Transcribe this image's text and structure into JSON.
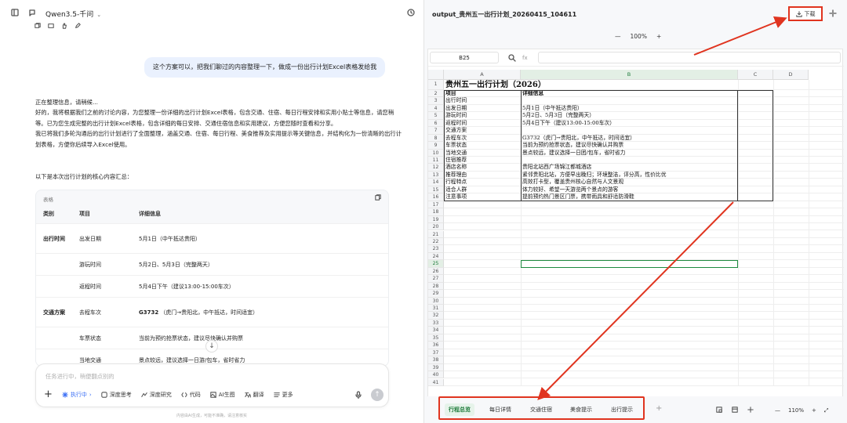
{
  "left": {
    "model_name": "Qwen3.5-千问",
    "user_message": "这个方案可以，把我们聊过的内容整理一下，做成一份出行计划Excel表格发给我",
    "assistant_paragraphs": [
      "正在整理信息，请稍候...",
      "好的，我将根据我们之前的讨论内容，为您整理一份详细的出行计划Excel表格，包含交通、住宿、每日行程安排和实用小贴士等信息，请您稍等。已为您生成完整的出行计划Excel表格，包含详细的每日安排、交通住宿信息和实用建议，方便您随时查看和分享。",
      "我已将我们多轮沟通后的出行计划进行了全面整理，涵盖交通、住宿、每日行程、美食推荐及实用提示等关键信息，并结构化为一份清晰的出行计划表格，方便你后续导入Excel使用。"
    ],
    "summary_text": "以下是本次出行计划的核心内容汇总：",
    "table_label": "表格",
    "table_headers": [
      "类别",
      "项目",
      "详细信息"
    ],
    "table_rows": [
      {
        "cat": "出行时间",
        "item": "出发日期",
        "detail": "5月1日（中午抵达贵阳）",
        "bold": false
      },
      {
        "cat": "",
        "item": "游玩时间",
        "detail": "5月2日、5月3日（完整两天）",
        "bold": false
      },
      {
        "cat": "",
        "item": "返程时间",
        "detail": "5月4日下午（建议13:00-15:00车次）",
        "bold": false
      },
      {
        "cat": "交通方案",
        "item": "去程车次",
        "detail_bold": "G3732",
        "detail": "（虎门→贵阳北，中午抵达，时间适宜）",
        "bold": true
      },
      {
        "cat": "",
        "item": "车票状态",
        "detail": "当前为预约抢票状态，建议尽快确认并购票",
        "bold": false
      },
      {
        "cat": "",
        "item": "当地交通",
        "detail": "景点较远，建议选择一日游/包车，省时省力",
        "bold": false
      }
    ],
    "input_placeholder": "任务进行中，稍便翻点别的",
    "toolbar": {
      "exec": "执行中",
      "deep_think": "深度思考",
      "deep_research": "深度研究",
      "code": "代码",
      "ai_image": "AI生图",
      "translate": "翻译",
      "more": "更多"
    },
    "footer": "内容由AI生成，可能不准确，请注意核实"
  },
  "right": {
    "file_name": "output_贵州五一出行计划_20260415_104611",
    "download_label": "下载",
    "zoom_top": "100%",
    "cell_ref": "B25",
    "fx_label": "fx",
    "columns": [
      "A",
      "B",
      "C",
      "D"
    ],
    "row_numbers": [
      "1",
      "2",
      "3",
      "4",
      "5",
      "6",
      "7",
      "8",
      "9",
      "10",
      "11",
      "12",
      "13",
      "14",
      "15",
      "16",
      "17",
      "18",
      "19",
      "20",
      "21",
      "22",
      "23",
      "24",
      "25",
      "26",
      "27",
      "28",
      "29",
      "30",
      "31",
      "32",
      "33",
      "34",
      "35",
      "36",
      "37",
      "38",
      "39",
      "40",
      "41"
    ],
    "sheet_title": "贵州五一出行计划（2026）",
    "sheet_header": [
      "项目",
      "详细信息"
    ],
    "sheet_rows": [
      [
        "出行时间",
        ""
      ],
      [
        "出发日期",
        "5月1日（中午抵达贵阳）"
      ],
      [
        "游玩时间",
        "5月2日、5月3日（完整两天）"
      ],
      [
        "返程时间",
        "5月4日下午（建议13:00-15:00车次）"
      ],
      [
        "交通方案",
        ""
      ],
      [
        "去程车次",
        "G3732（虎门→贵阳北，中午抵达，时间适宜）"
      ],
      [
        "车票状态",
        "当前为预约抢票状态，建议尽快确认并购票"
      ],
      [
        "当地交通",
        "景点较远，建议选择一日团/包车，省时省力"
      ],
      [
        "住宿推荐",
        ""
      ],
      [
        "酒店名称",
        "贵阳北站西广场锦江都城酒店"
      ],
      [
        "推荐理由",
        "紧邻贵阳北站，方便早出晚归；环境整洁，评分高，性价比优"
      ],
      [
        "行程特点",
        "高效打卡型，覆盖贵州核心自然与人文景观"
      ],
      [
        "适合人群",
        "体力较好、希望一天游览两个景点的游客"
      ],
      [
        "注意事项",
        "提前预约热门景区门票，携带雨具和舒适防滑鞋"
      ]
    ],
    "sheet_tabs": [
      "行程总览",
      "每日详情",
      "交通住宿",
      "美食提示",
      "出行提示"
    ],
    "active_tab": 0,
    "zoom_bottom": "110%",
    "accent_color": "#1d7a3a",
    "annotation_color": "#e0341f"
  }
}
